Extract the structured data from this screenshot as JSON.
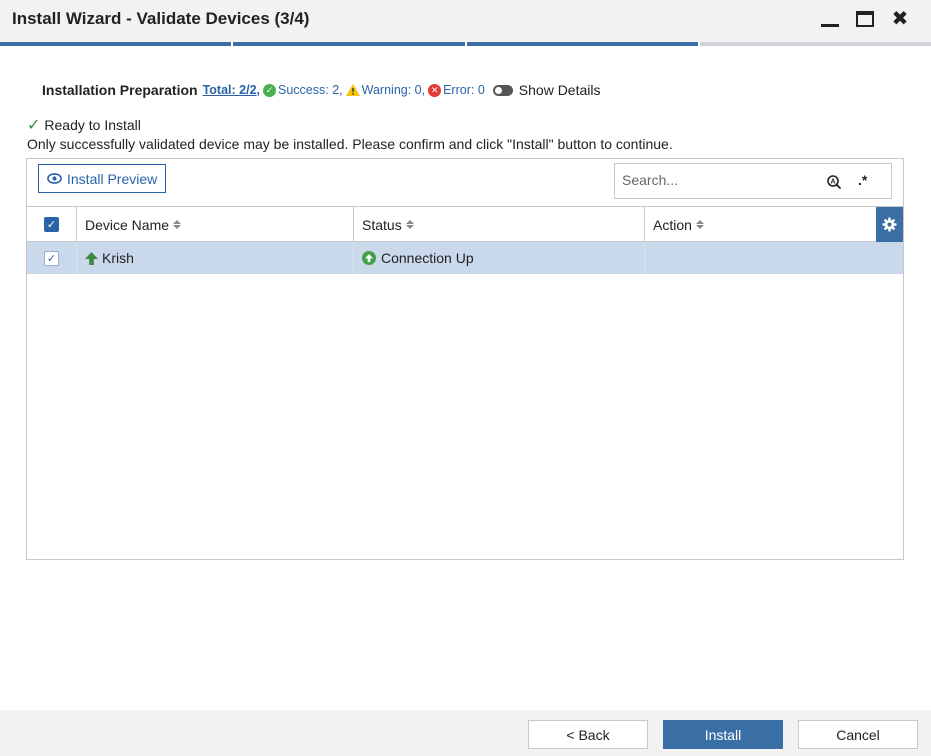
{
  "window": {
    "title": "Install Wizard - Validate Devices (3/4)",
    "step_current": 3,
    "step_total": 4
  },
  "preparation": {
    "label": "Installation Preparation",
    "total_link": "Total: 2/2,",
    "success_text": "Success: 2,",
    "warning_text": "Warning: 0,",
    "error_text": "Error: 0",
    "show_details_label": "Show Details",
    "show_details_on": false
  },
  "status": {
    "ready_text": "Ready to Install",
    "info_text": "Only successfully validated device may be installed. Please confirm and click \"Install\" button to continue."
  },
  "toolbar": {
    "install_preview_label": "Install Preview",
    "search_placeholder": "Search...",
    "regex_label": ".*"
  },
  "table": {
    "columns": [
      {
        "label": "Device Name"
      },
      {
        "label": "Status"
      },
      {
        "label": "Action"
      }
    ],
    "rows": [
      {
        "device_name": "Krish",
        "status": "Connection Up",
        "action": "",
        "selected": true
      }
    ]
  },
  "footer": {
    "back_label": "< Back",
    "install_label": "Install",
    "cancel_label": "Cancel"
  },
  "colors": {
    "accent": "#3a6fa6",
    "link": "#2a63a8",
    "success": "#4caf50",
    "warning": "#f4c20d",
    "error": "#e53935",
    "row_selected": "#c9d8ea"
  }
}
